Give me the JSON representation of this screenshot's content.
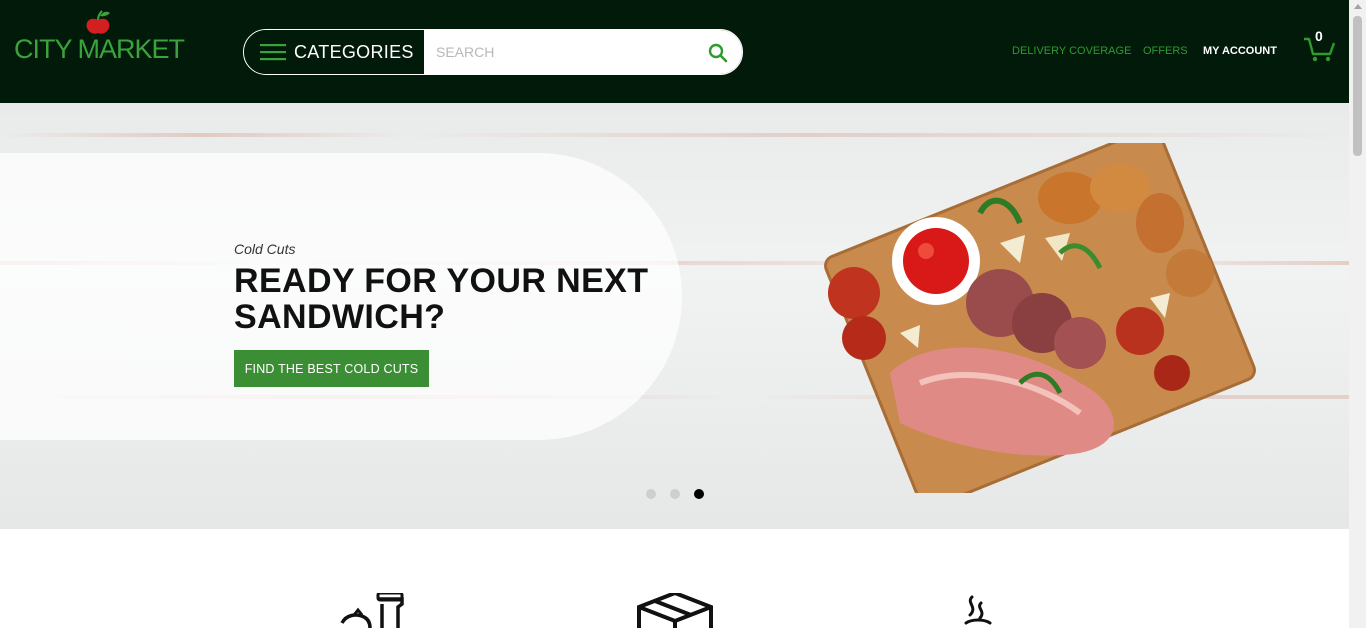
{
  "brand": {
    "name": "CITY MARKET",
    "accent_color": "#3aa33a",
    "header_bg": "#021a0a",
    "apple_color": "#d21f1f"
  },
  "header": {
    "categories_label": "CATEGORIES",
    "search_placeholder": "SEARCH",
    "nav": {
      "delivery": "DELIVERY COVERAGE",
      "offers": "OFFERS",
      "account": "MY ACCOUNT"
    },
    "cart_count": "0",
    "icons": {
      "menu": "hamburger-icon",
      "search": "search-icon",
      "cart": "cart-icon"
    }
  },
  "hero": {
    "kicker": "Cold Cuts",
    "title": "READY FOR YOUR NEXT SANDWICH?",
    "cta_label": "FIND THE BEST COLD CUTS",
    "cta_color": "#3c8e35",
    "slides_total": 3,
    "active_slide": 3
  },
  "categories_row": {
    "icons": [
      "dairy-icon",
      "packaged-goods-icon",
      "hot-food-icon"
    ]
  }
}
